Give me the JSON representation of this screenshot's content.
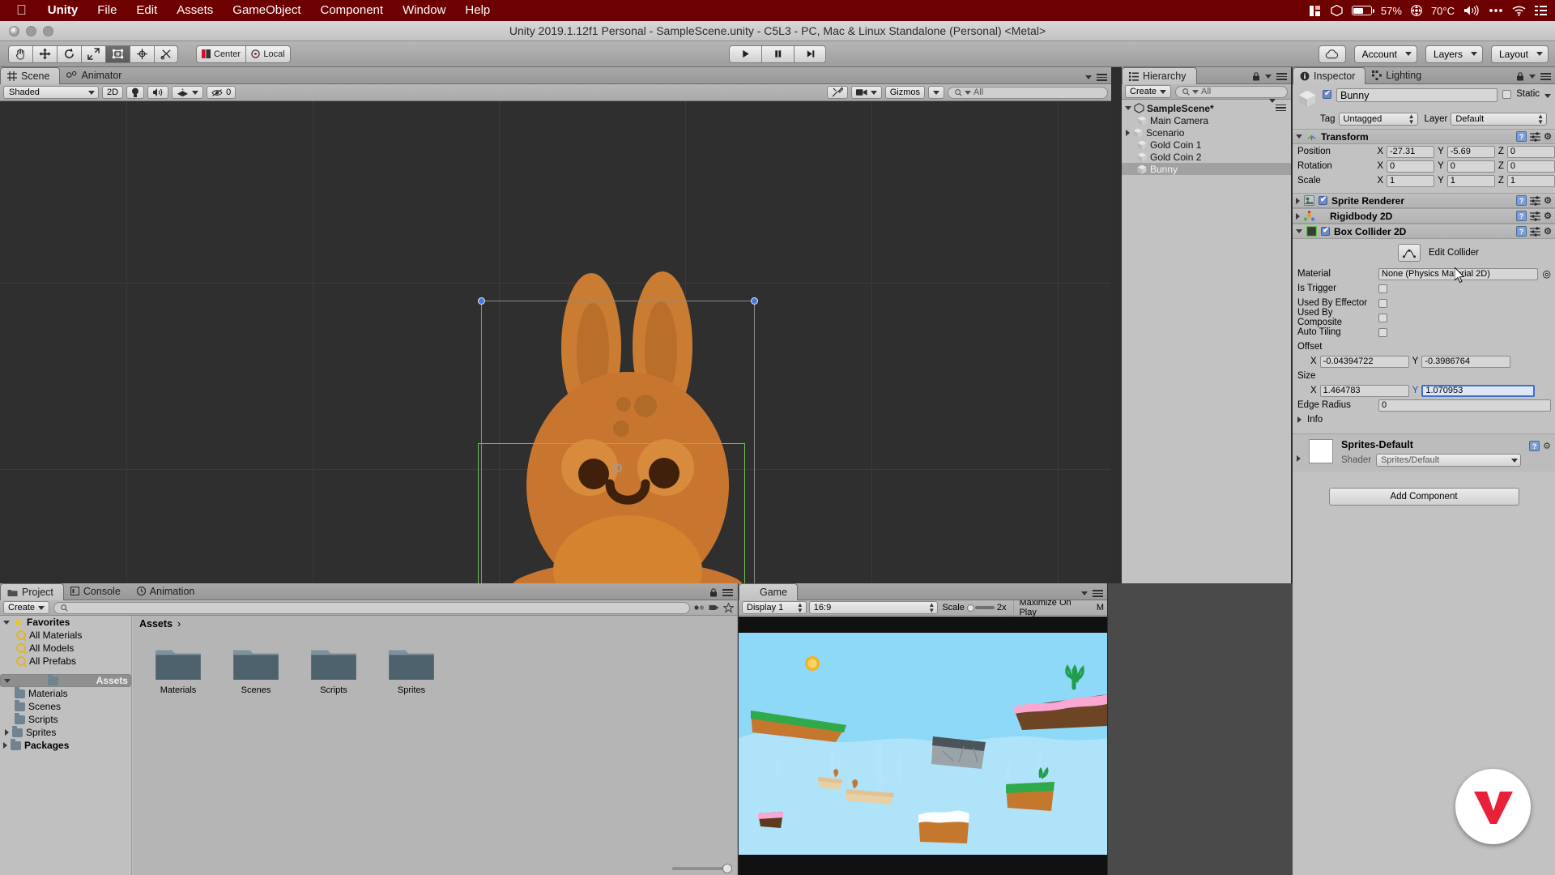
{
  "macbar": {
    "apple_icon": "apple-icon",
    "items": [
      "Unity",
      "File",
      "Edit",
      "Assets",
      "GameObject",
      "Component",
      "Window",
      "Help"
    ],
    "status": {
      "grid_icon": "display-grid-icon",
      "unity_icon": "unity-cloud-icon",
      "battery_icon": "battery-icon",
      "battery": "57%",
      "fan_icon": "fan-icon",
      "temperature": "70°C",
      "volume_icon": "volume-icon",
      "more_icon": "ellipsis-icon",
      "wifi_icon": "wifi-icon",
      "controlcenter_icon": "control-center-icon"
    }
  },
  "window": {
    "title": "Unity 2019.1.12f1 Personal - SampleScene.unity - C5L3 - PC, Mac & Linux Standalone (Personal) <Metal>"
  },
  "toolbar": {
    "tools": [
      {
        "name": "hand-tool",
        "glyph": "✋"
      },
      {
        "name": "move-tool",
        "glyph": "✥"
      },
      {
        "name": "rotate-tool",
        "glyph": "↻"
      },
      {
        "name": "scale-tool",
        "glyph": "⤡"
      },
      {
        "name": "rect-tool",
        "glyph": "▣"
      },
      {
        "name": "transform-tool",
        "glyph": "✣"
      },
      {
        "name": "custom-tool",
        "glyph": "✂"
      }
    ],
    "pivot": "Center",
    "handle": "Local",
    "play": "▶",
    "pause": "‖",
    "step": "▶|",
    "cloud_icon": "cloud-icon",
    "account": "Account",
    "layers": "Layers",
    "layout": "Layout"
  },
  "scene": {
    "tabs": [
      {
        "label": "Scene",
        "icon": "scene-grid-icon",
        "active": true
      },
      {
        "label": "Animator",
        "icon": "animator-icon",
        "active": false
      }
    ],
    "draw_mode": "Shaded",
    "mode_2d": "2D",
    "lighting_icon": "lightbulb-icon",
    "audio_icon": "speaker-icon",
    "fx_icon": "effects-icon",
    "hidden_count": "0",
    "tools_icon": "wrench-icon",
    "camera_icon": "camera-icon",
    "gizmos": "Gizmos",
    "search_placeholder": "All"
  },
  "hierarchy": {
    "tab": "Hierarchy",
    "tab_icon": "hierarchy-icon",
    "create": "Create",
    "search_placeholder": "All",
    "scene_name": "SampleScene*",
    "items": [
      {
        "label": "Main Camera",
        "depth": 1,
        "expandable": false,
        "selected": false
      },
      {
        "label": "Scenario",
        "depth": 1,
        "expandable": true,
        "selected": false
      },
      {
        "label": "Gold Coin 1",
        "depth": 1,
        "expandable": false,
        "selected": false
      },
      {
        "label": "Gold Coin 2",
        "depth": 1,
        "expandable": false,
        "selected": false
      },
      {
        "label": "Bunny",
        "depth": 1,
        "expandable": false,
        "selected": true
      }
    ]
  },
  "inspector": {
    "tabs": [
      {
        "label": "Inspector",
        "icon": "info-icon",
        "active": true
      },
      {
        "label": "Lighting",
        "icon": "lighting-icon",
        "active": false
      }
    ],
    "object_name": "Bunny",
    "object_enabled": true,
    "static_label": "Static",
    "static_checked": false,
    "tag_label": "Tag",
    "tag_value": "Untagged",
    "layer_label": "Layer",
    "layer_value": "Default",
    "transform": {
      "title": "Transform",
      "rows": [
        {
          "label": "Position",
          "x": "-27.31",
          "y": "-5.69",
          "z": "0"
        },
        {
          "label": "Rotation",
          "x": "0",
          "y": "0",
          "z": "0"
        },
        {
          "label": "Scale",
          "x": "1",
          "y": "1",
          "z": "1"
        }
      ]
    },
    "sprite_renderer": {
      "title": "Sprite Renderer",
      "enabled": true,
      "expanded": false
    },
    "rigidbody2d": {
      "title": "Rigidbody 2D",
      "expanded": false
    },
    "box_collider": {
      "title": "Box Collider 2D",
      "enabled": true,
      "edit_collider_label": "Edit Collider",
      "edit_collider_icon": "edit-collider-icon",
      "material_label": "Material",
      "material_value": "None (Physics Material 2D)",
      "is_trigger_label": "Is Trigger",
      "is_trigger": false,
      "used_by_effector_label": "Used By Effector",
      "used_by_effector": false,
      "used_by_composite_label": "Used By Composite",
      "used_by_composite": false,
      "auto_tiling_label": "Auto Tiling",
      "auto_tiling": false,
      "offset_label": "Offset",
      "offset_x": "-0.04394722",
      "offset_y": "-0.3986764",
      "size_label": "Size",
      "size_x": "1.464783",
      "size_y": "1.070953",
      "size_y_focused": true,
      "edge_radius_label": "Edge Radius",
      "edge_radius": "0",
      "info_label": "Info"
    },
    "material": {
      "name": "Sprites-Default",
      "shader_label": "Shader",
      "shader_value": "Sprites/Default"
    },
    "add_component": "Add Component"
  },
  "project": {
    "tabs": [
      {
        "label": "Project",
        "icon": "folder-icon",
        "active": true
      },
      {
        "label": "Console",
        "icon": "console-icon",
        "active": false
      },
      {
        "label": "Animation",
        "icon": "clock-icon",
        "active": false
      }
    ],
    "create": "Create",
    "search_placeholder": "",
    "tree": [
      {
        "label": "Favorites",
        "type": "star",
        "depth": 0,
        "expandable": true
      },
      {
        "label": "All Materials",
        "type": "search",
        "depth": 1,
        "expandable": false
      },
      {
        "label": "All Models",
        "type": "search",
        "depth": 1,
        "expandable": false
      },
      {
        "label": "All Prefabs",
        "type": "search",
        "depth": 1,
        "expandable": false
      },
      {
        "label": "Assets",
        "type": "folder",
        "depth": 0,
        "expandable": true,
        "selected": true
      },
      {
        "label": "Materials",
        "type": "folder",
        "depth": 1,
        "expandable": false
      },
      {
        "label": "Scenes",
        "type": "folder",
        "depth": 1,
        "expandable": false
      },
      {
        "label": "Scripts",
        "type": "folder",
        "depth": 1,
        "expandable": false
      },
      {
        "label": "Sprites",
        "type": "folder",
        "depth": 1,
        "expandable": true
      },
      {
        "label": "Packages",
        "type": "folder",
        "depth": 0,
        "expandable": true
      }
    ],
    "breadcrumb": "Assets",
    "assets": [
      "Materials",
      "Scenes",
      "Scripts",
      "Sprites"
    ]
  },
  "game": {
    "tab": "Game",
    "tab_icon": "gamepad-icon",
    "display": "Display 1",
    "aspect": "16:9",
    "scale_label": "Scale",
    "scale_value": "2x",
    "maximize": "Maximize On Play",
    "mute": "M"
  },
  "colors": {
    "menubar": "#6d0000",
    "panel": "#c2c2c2",
    "scene_bg": "#2f2f2f",
    "selection_blue": "#3c6fd0",
    "collider_green": "#6fbf5e",
    "sky": "#8ed8f8",
    "bunny": "#c9762f",
    "accent_red": "#e8203a"
  }
}
